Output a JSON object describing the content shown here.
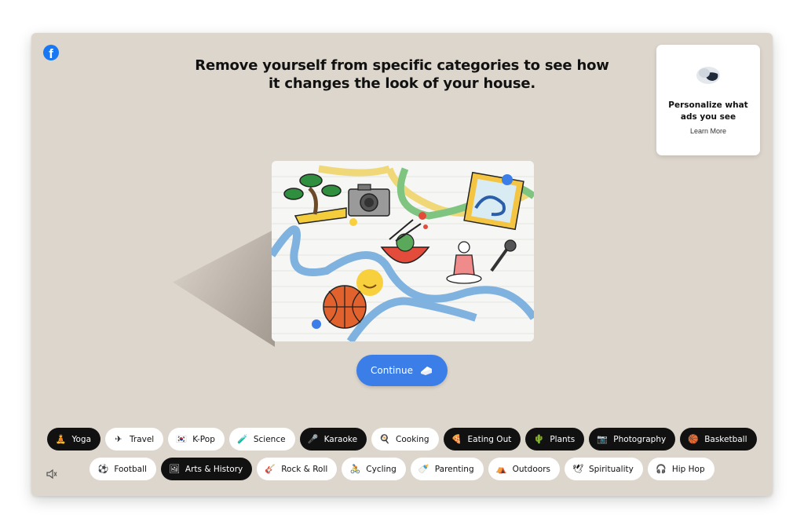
{
  "headline": "Remove yourself from specific categories to see how it changes the look of your house.",
  "card": {
    "title": "Personalize what ads you see",
    "link": "Learn More"
  },
  "continue_label": "Continue",
  "brand": {
    "logo_icon": "facebook-logo-icon",
    "accent": "#1877f2",
    "button_color": "#3b7ee8",
    "background": "#ddd6cc"
  },
  "categories_row1": [
    {
      "label": "Yoga",
      "icon": "🧘",
      "selected": true
    },
    {
      "label": "Travel",
      "icon": "✈",
      "selected": false
    },
    {
      "label": "K-Pop",
      "icon": "🇰🇷",
      "selected": false
    },
    {
      "label": "Science",
      "icon": "🧪",
      "selected": false
    },
    {
      "label": "Karaoke",
      "icon": "🎤",
      "selected": true
    },
    {
      "label": "Cooking",
      "icon": "🍳",
      "selected": false
    },
    {
      "label": "Eating Out",
      "icon": "🍕",
      "selected": true
    },
    {
      "label": "Plants",
      "icon": "🌵",
      "selected": true
    },
    {
      "label": "Photography",
      "icon": "📷",
      "selected": true
    },
    {
      "label": "Basketball",
      "icon": "🏀",
      "selected": true
    }
  ],
  "categories_row2": [
    {
      "label": "Football",
      "icon": "⚽",
      "selected": false
    },
    {
      "label": "Arts & History",
      "icon": "🖼",
      "selected": true
    },
    {
      "label": "Rock & Roll",
      "icon": "🎸",
      "selected": false
    },
    {
      "label": "Cycling",
      "icon": "🚴",
      "selected": false
    },
    {
      "label": "Parenting",
      "icon": "🍼",
      "selected": false
    },
    {
      "label": "Outdoors",
      "icon": "⛺",
      "selected": false
    },
    {
      "label": "Spirituality",
      "icon": "🕊",
      "selected": false
    },
    {
      "label": "Hip Hop",
      "icon": "🎧",
      "selected": false
    }
  ]
}
